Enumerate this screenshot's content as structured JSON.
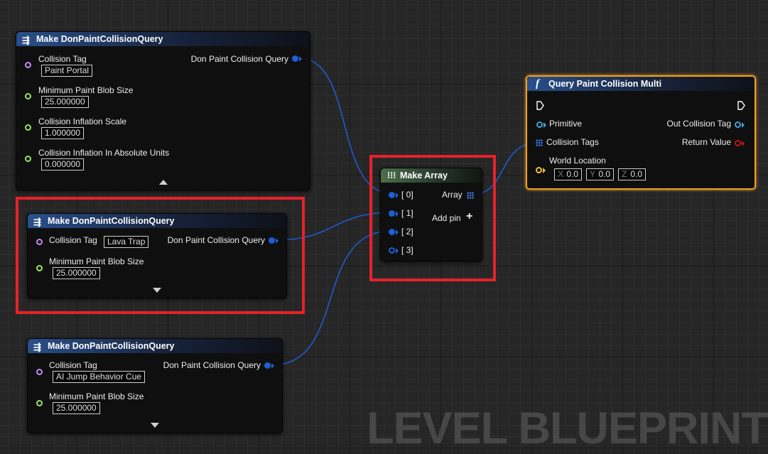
{
  "node1": {
    "title": "Make DonPaintCollisionQuery",
    "pins": [
      {
        "label": "Collision Tag",
        "value": "Paint Portal"
      },
      {
        "label": "Minimum Paint Blob Size",
        "value": "25.000000"
      },
      {
        "label": "Collision Inflation Scale",
        "value": "1.000000"
      },
      {
        "label": "Collision Inflation In Absolute Units",
        "value": "0.000000"
      }
    ],
    "output": "Don Paint Collision Query"
  },
  "node2": {
    "title": "Make DonPaintCollisionQuery",
    "pins": [
      {
        "label": "Collision Tag",
        "value": "Lava Trap"
      },
      {
        "label": "Minimum Paint Blob Size",
        "value": "25.000000"
      }
    ],
    "output": "Don Paint Collision Query"
  },
  "node3": {
    "title": "Make DonPaintCollisionQuery",
    "pins": [
      {
        "label": "Collision Tag",
        "value": "AI Jump Behavior Cue"
      },
      {
        "label": "Minimum Paint Blob Size",
        "value": "25.000000"
      }
    ],
    "output": "Don Paint Collision Query"
  },
  "make_array": {
    "title": "Make Array",
    "inputs": [
      "[ 0]",
      "[ 1]",
      "[ 2]",
      "[ 3]"
    ],
    "output": "Array",
    "add_pin": "Add pin"
  },
  "query_node": {
    "title": "Query Paint Collision Multi",
    "inputs": [
      "Primitive",
      "Collision Tags",
      "World Location"
    ],
    "outputs": [
      "Out Collision Tag",
      "Return Value"
    ],
    "location": {
      "x_label": "X",
      "x": "0.0",
      "y_label": "Y",
      "y": "0.0",
      "z_label": "Z",
      "z": "0.0"
    }
  },
  "watermark": "LEVEL BLUEPRINT",
  "colors": {
    "struct_pin": "#1f5fd6",
    "name_pin": "#c58bf0",
    "float_pin": "#9be65a",
    "vector_pin": "#f0c23a",
    "bool_pin": "#c01818",
    "highlight": "#e5222a",
    "selected": "#f0a020"
  }
}
